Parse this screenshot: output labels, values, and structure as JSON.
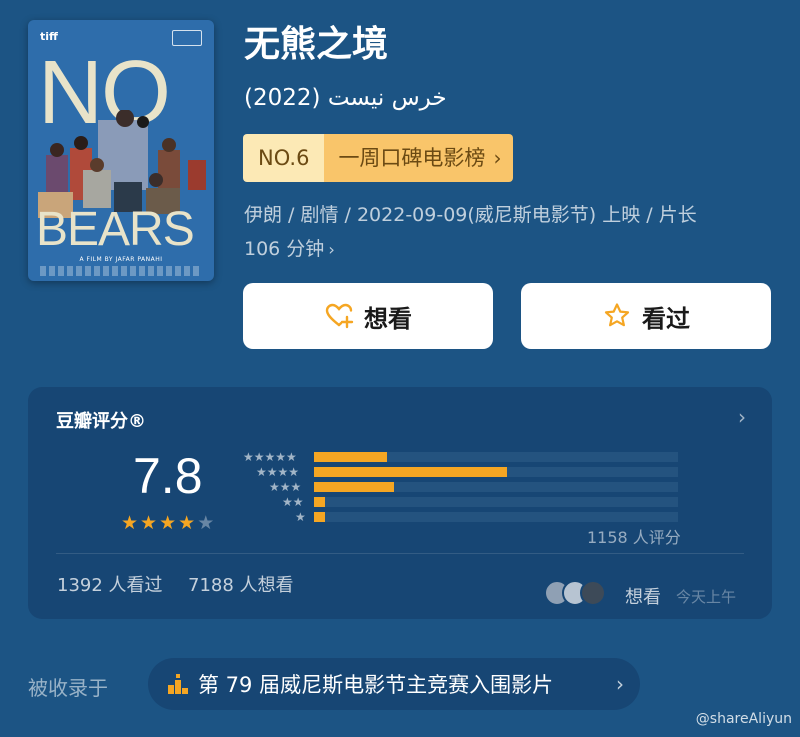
{
  "poster": {
    "festival_logo": "tiff",
    "title_top": "NO",
    "title_bottom": "BEARS",
    "credit": "A FILM BY JAFAR PANAHI"
  },
  "movie": {
    "title": "无熊之境",
    "original_title": "خرس نیست (2022)",
    "rank_no": "NO.6",
    "rank_name": "一周口碑电影榜",
    "meta_line1": "伊朗 / 剧情 / 2022-09-09(威尼斯电影节) 上映 / 片长",
    "meta_line2": "106 分钟"
  },
  "actions": {
    "want_label": "想看",
    "seen_label": "看过"
  },
  "rating": {
    "label": "豆瓣评分®",
    "score": "7.8",
    "stars_filled": 4,
    "stars_total": 5,
    "distribution": [
      {
        "stars": 5,
        "value": 0.2
      },
      {
        "stars": 4,
        "value": 0.53
      },
      {
        "stars": 3,
        "value": 0.22
      },
      {
        "stars": 2,
        "value": 0.03
      },
      {
        "stars": 1,
        "value": 0.03
      }
    ],
    "votes_text": "1158 人评分",
    "seen_text": "1392 人看过",
    "want_text": "7188 人想看",
    "feed_action": "想看",
    "feed_time": "今天上午"
  },
  "included": {
    "label": "被收录于",
    "list_name": "第 79 届威尼斯电影节主竞赛入围影片"
  },
  "watermark": "@shareAliyun",
  "colors": {
    "background": "#1c5484",
    "card": "#174674",
    "accent": "#f5a623",
    "rank_light": "#fce9b5",
    "rank_dark": "#f9c56a"
  }
}
